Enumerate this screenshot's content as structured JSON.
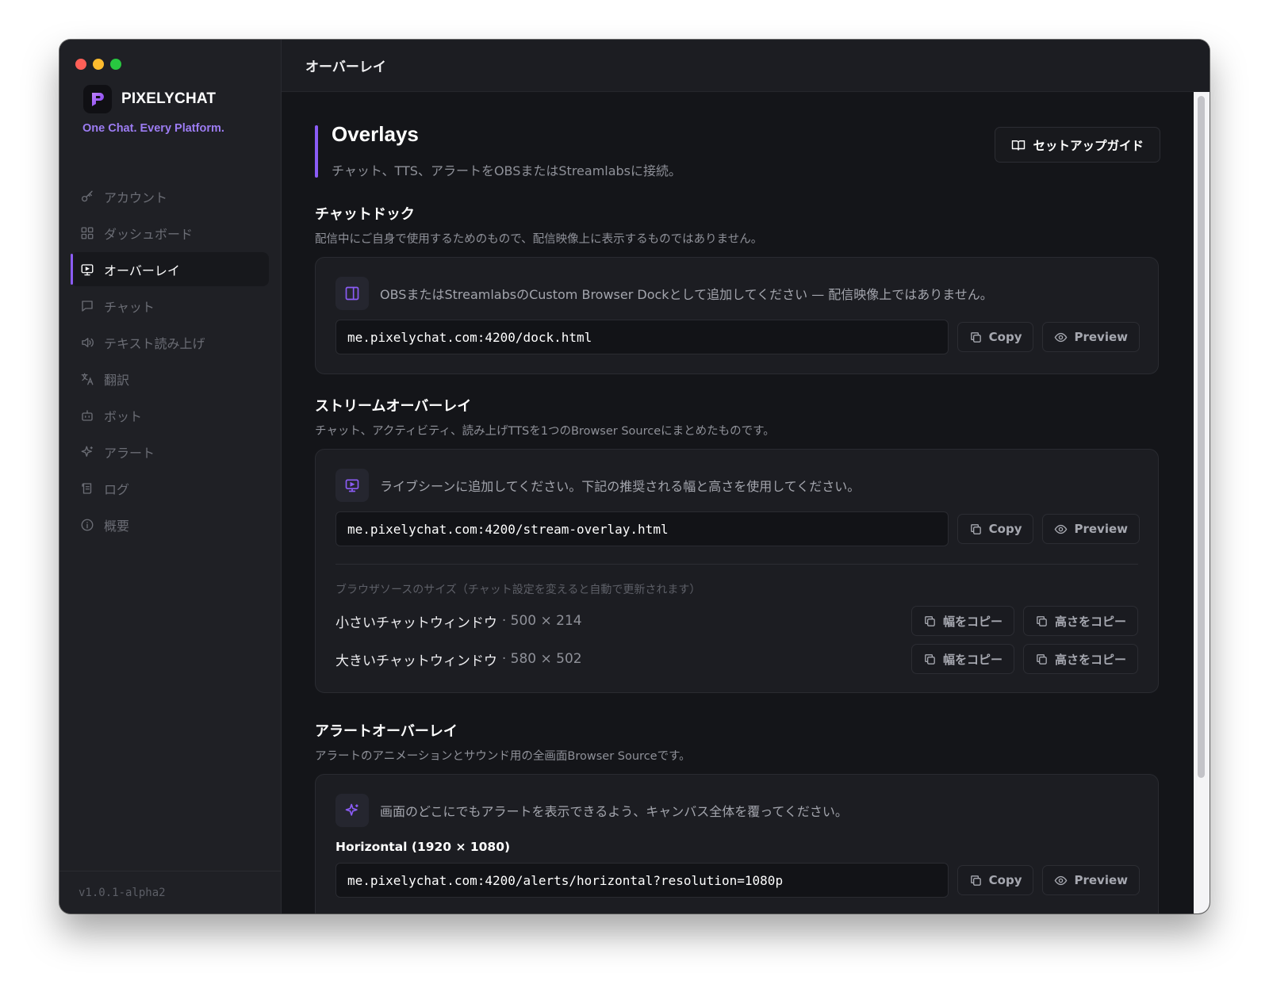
{
  "window": {
    "topbar_title": "オーバーレイ",
    "traffic_colors": [
      "#ff5f57",
      "#febc2e",
      "#28c840"
    ]
  },
  "sidebar": {
    "brand": "PIXELYCHAT",
    "tagline": "One Chat. Every Platform.",
    "items": [
      {
        "label": "アカウント",
        "icon": "key-icon"
      },
      {
        "label": "ダッシュボード",
        "icon": "grid-icon"
      },
      {
        "label": "オーバーレイ",
        "icon": "monitor-icon",
        "active": true
      },
      {
        "label": "チャット",
        "icon": "chat-bubble-icon"
      },
      {
        "label": "テキスト読み上げ",
        "icon": "speaker-icon"
      },
      {
        "label": "翻訳",
        "icon": "translate-icon"
      },
      {
        "label": "ボット",
        "icon": "bot-icon"
      },
      {
        "label": "アラート",
        "icon": "sparkle-icon"
      },
      {
        "label": "ログ",
        "icon": "scroll-icon"
      },
      {
        "label": "概要",
        "icon": "info-icon"
      }
    ],
    "version": "v1.0.1-alpha2"
  },
  "header": {
    "title": "Overlays",
    "subtitle": "チャット、TTS、アラートをOBSまたはStreamlabsに接続。",
    "guide_button": "セットアップガイド"
  },
  "chat_dock": {
    "title": "チャットドック",
    "subtitle": "配信中にご自身で使用するためのもので、配信映像上に表示するものではありません。",
    "description": "OBSまたはStreamlabsのCustom Browser Dockとして追加してください — 配信映像上ではありません。",
    "url": "me.pixelychat.com:4200/dock.html",
    "copy": "Copy",
    "preview": "Preview"
  },
  "stream_overlay": {
    "title": "ストリームオーバーレイ",
    "subtitle": "チャット、アクティビティ、読み上げTTSを1つのBrowser Sourceにまとめたものです。",
    "description": "ライブシーンに追加してください。下記の推奨される幅と高さを使用してください。",
    "url": "me.pixelychat.com:4200/stream-overlay.html",
    "copy": "Copy",
    "preview": "Preview",
    "size_label": "ブラウザソースのサイズ（チャット設定を変えると自動で更新されます）",
    "sizes": [
      {
        "name": "小さいチャットウィンドウ",
        "dims": "· 500 × 214",
        "copy_width": "幅をコピー",
        "copy_height": "高さをコピー"
      },
      {
        "name": "大きいチャットウィンドウ",
        "dims": "· 580 × 502",
        "copy_width": "幅をコピー",
        "copy_height": "高さをコピー"
      }
    ]
  },
  "alert_overlay": {
    "title": "アラートオーバーレイ",
    "subtitle": "アラートのアニメーションとサウンド用の全画面Browser Sourceです。",
    "description": "画面のどこにでもアラートを表示できるよう、キャンバス全体を覆ってください。",
    "horizontal_label": "Horizontal (1920 × 1080)",
    "url": "me.pixelychat.com:4200/alerts/horizontal?resolution=1080p",
    "copy": "Copy",
    "preview": "Preview"
  },
  "colors": {
    "accent": "#8b5cf6",
    "tagline": "#9c7cf2"
  }
}
